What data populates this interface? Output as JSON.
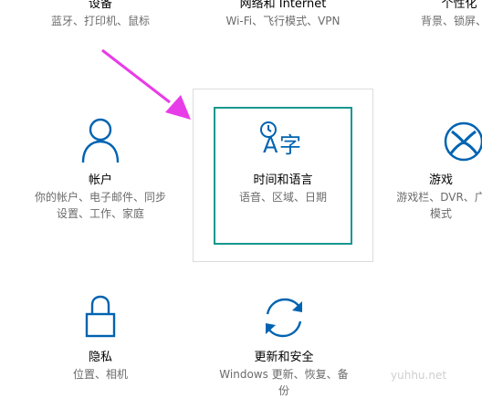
{
  "tiles": {
    "devices": {
      "title": "设备",
      "desc": "蓝牙、打印机、鼠标"
    },
    "network": {
      "title": "网络和 Internet",
      "desc": "Wi-Fi、飞行模式、VPN"
    },
    "personalization": {
      "title": "个性化",
      "desc": "背景、锁屏、颜"
    },
    "accounts": {
      "title": "帐户",
      "desc_line1": "你的帐户、电子邮件、同步",
      "desc_line2": "设置、工作、家庭"
    },
    "time_language": {
      "title": "时间和语言",
      "desc": "语音、区域、日期"
    },
    "gaming": {
      "title": "游戏",
      "desc_line1": "游戏栏、DVR、广",
      "desc_line2": "模式"
    },
    "privacy": {
      "title": "隐私",
      "desc": "位置、相机"
    },
    "update_security": {
      "title": "更新和安全",
      "desc_line1": "Windows 更新、恢复、备",
      "desc_line2": "份"
    }
  },
  "time_icon_glyph": "字",
  "time_icon_letter": "A",
  "watermark": "yuhhu.net",
  "colors": {
    "accent": "#0063b1",
    "focus": "#16988e",
    "arrow": "#e83ce8"
  }
}
